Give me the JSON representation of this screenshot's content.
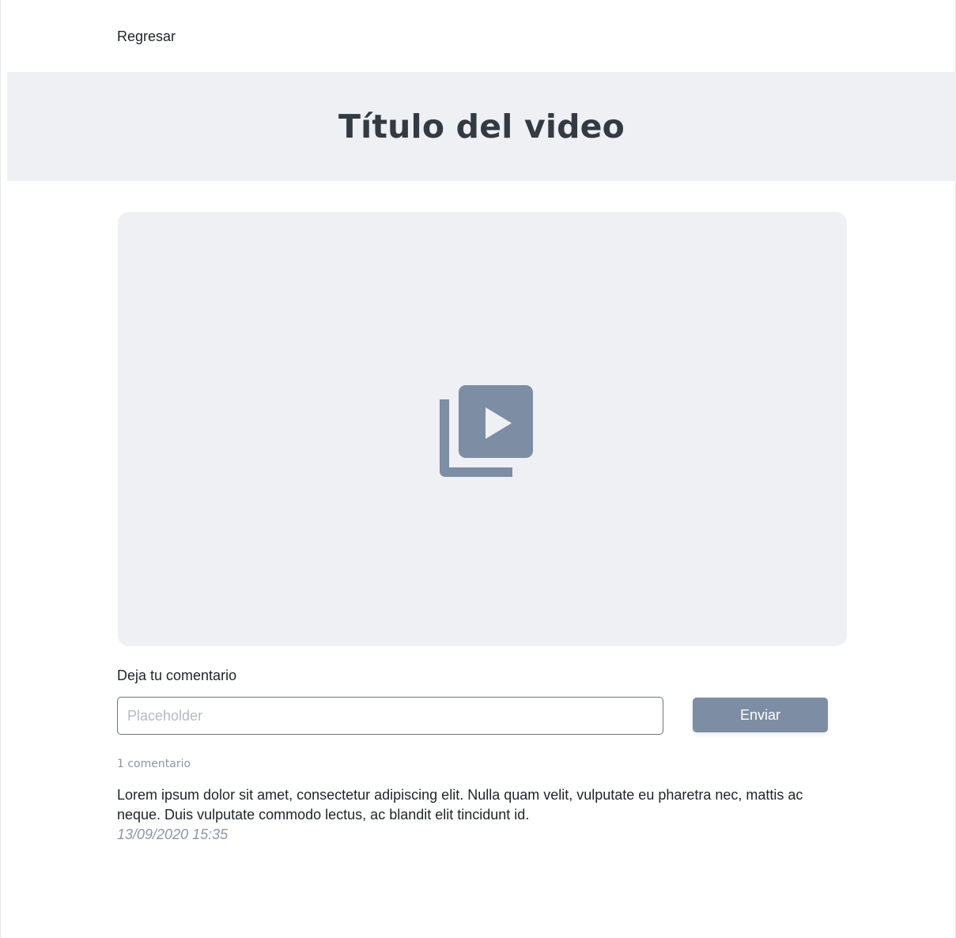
{
  "nav": {
    "back_label": "Regresar"
  },
  "header": {
    "title": "Título del video"
  },
  "video": {
    "icon": "video-library-icon",
    "icon_color": "#7d8da3",
    "background_color": "#eef0f4"
  },
  "comment_form": {
    "label": "Deja tu comentario",
    "input_value": "",
    "input_placeholder": "Placeholder",
    "send_label": "Enviar",
    "send_color": "#7d8da3"
  },
  "comments": {
    "count_label": "1 comentario",
    "items": [
      {
        "text": "Lorem ipsum dolor sit amet, consectetur adipiscing elit. Nulla quam velit, vulputate eu pharetra nec, mattis ac neque. Duis vulputate commodo lectus, ac blandit elit tincidunt id.",
        "date": "13/09/2020 15:35"
      }
    ]
  }
}
